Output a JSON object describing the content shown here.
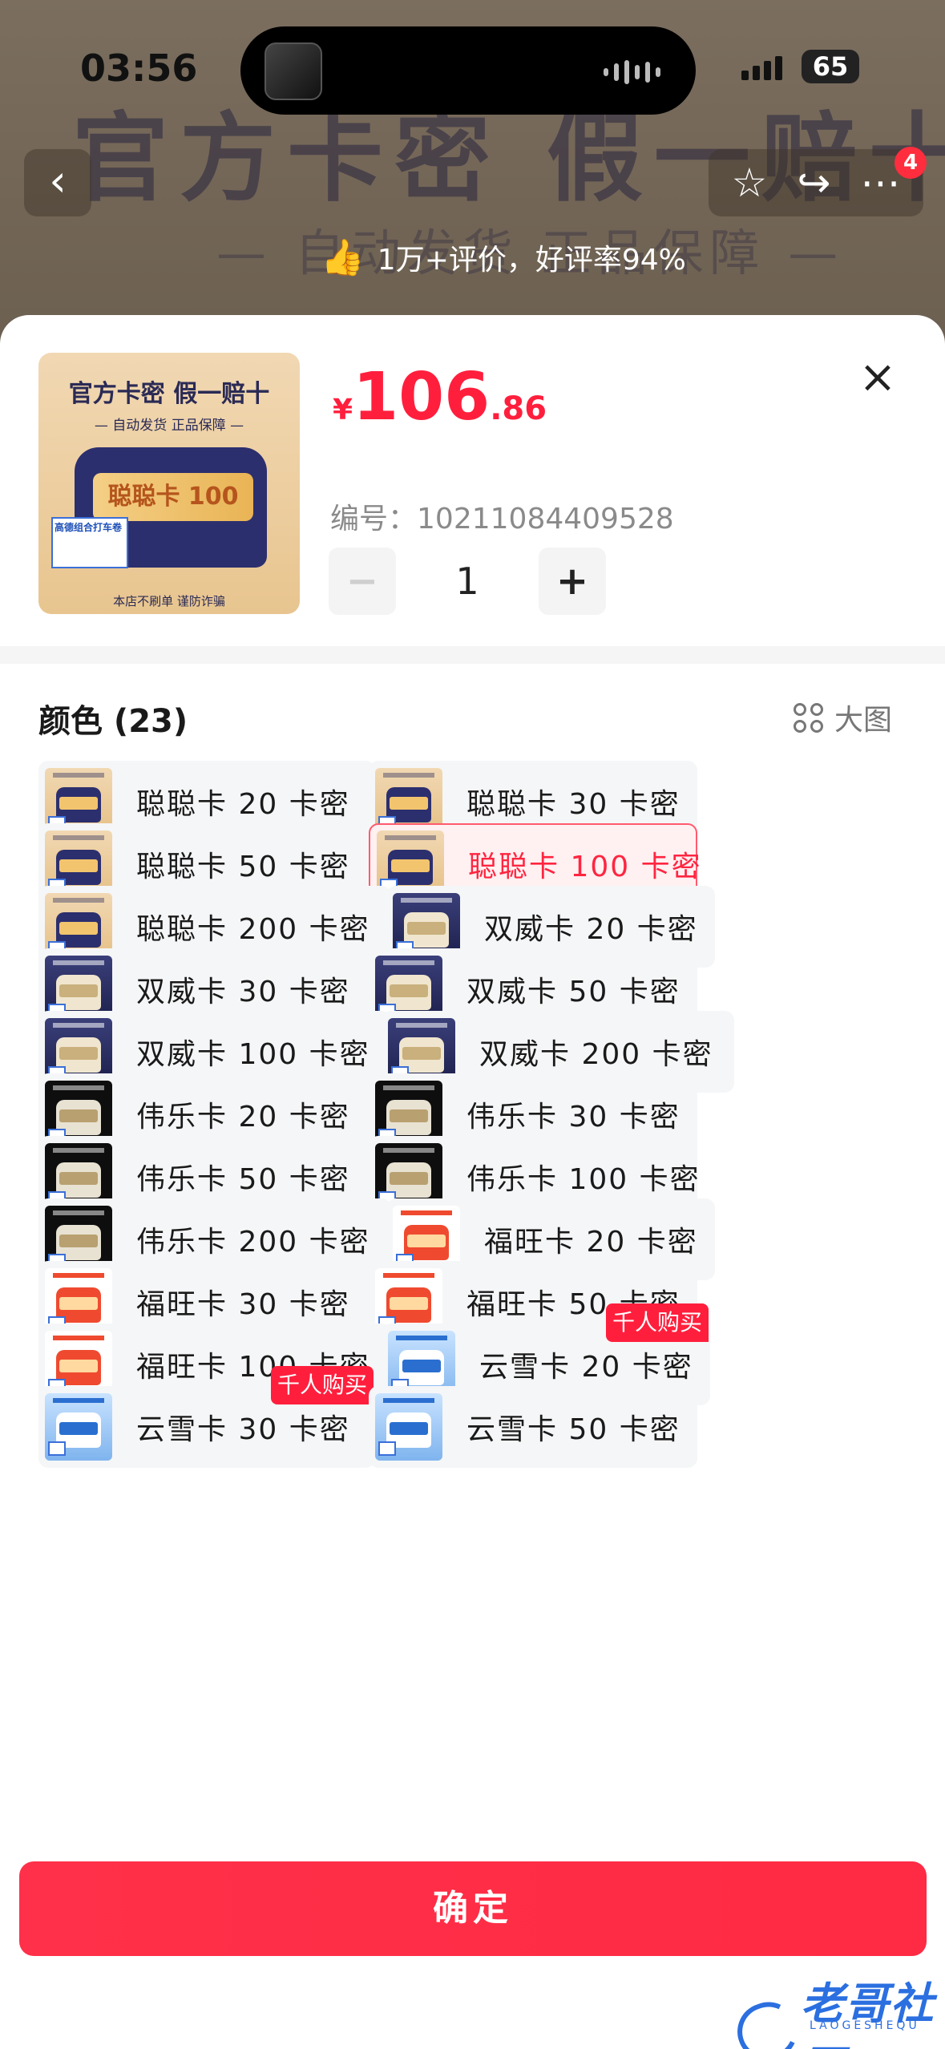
{
  "status_bar": {
    "time": "03:56",
    "battery": "65"
  },
  "background": {
    "banner_title": "官方卡密 假一赔十",
    "banner_subtitle": "— 自动发货 正品保障 —",
    "rating": "1万+评价，好评率94%",
    "cart_badge": "4"
  },
  "product": {
    "image": {
      "title": "官方卡密 假一赔十",
      "subtitle": "— 自动发货 正品保障 —",
      "card_text": "聪聪卡 100",
      "tag_text": "高德组合打车卷",
      "bottom_text": "本店不刷单 谨防诈骗"
    },
    "price_currency": "¥",
    "price_integer": "106",
    "price_decimal": ".86",
    "sku_label": "编号：",
    "sku_value": "10211084409528",
    "quantity": "1",
    "minus_label": "−",
    "plus_label": "+",
    "close_label": "×"
  },
  "options": {
    "title": "颜色 (23)",
    "big_view_label": "大图",
    "selected_index": 3,
    "items": [
      {
        "label": "聪聪卡 20 卡密",
        "thumb": "cong"
      },
      {
        "label": "聪聪卡 30 卡密",
        "thumb": "cong"
      },
      {
        "label": "聪聪卡 50 卡密",
        "thumb": "cong"
      },
      {
        "label": "聪聪卡 100 卡密",
        "thumb": "cong"
      },
      {
        "label": "聪聪卡 200 卡密",
        "thumb": "cong"
      },
      {
        "label": "双威卡 20 卡密",
        "thumb": "shuang"
      },
      {
        "label": "双威卡 30 卡密",
        "thumb": "shuang"
      },
      {
        "label": "双威卡 50 卡密",
        "thumb": "shuang"
      },
      {
        "label": "双威卡 100 卡密",
        "thumb": "shuang"
      },
      {
        "label": "双威卡 200 卡密",
        "thumb": "shuang"
      },
      {
        "label": "伟乐卡 20 卡密",
        "thumb": "wei"
      },
      {
        "label": "伟乐卡 30 卡密",
        "thumb": "wei"
      },
      {
        "label": "伟乐卡 50 卡密",
        "thumb": "wei"
      },
      {
        "label": "伟乐卡 100 卡密",
        "thumb": "wei"
      },
      {
        "label": "伟乐卡 200 卡密",
        "thumb": "wei"
      },
      {
        "label": "福旺卡 20 卡密",
        "thumb": "fu"
      },
      {
        "label": "福旺卡 30 卡密",
        "thumb": "fu"
      },
      {
        "label": "福旺卡 50 卡密",
        "thumb": "fu"
      },
      {
        "label": "福旺卡 100 卡密",
        "thumb": "fu"
      },
      {
        "label": "云雪卡 20 卡密",
        "thumb": "yun",
        "badge": "千人购买"
      },
      {
        "label": "云雪卡 30 卡密",
        "thumb": "yun",
        "badge": "千人购买"
      },
      {
        "label": "云雪卡 50 卡密",
        "thumb": "yun"
      }
    ]
  },
  "confirm_label": "确定",
  "watermark": {
    "text": "老哥社区",
    "sub": "LAOGESHEQU"
  },
  "colors": {
    "accent": "#ff1f3d",
    "selected_bg": "#fff0f1",
    "chip_bg": "#f5f6f7"
  }
}
